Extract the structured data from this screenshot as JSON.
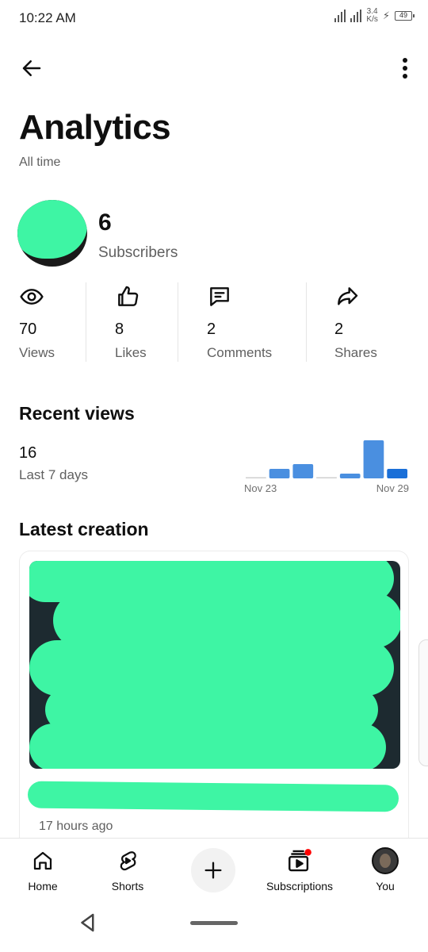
{
  "status_bar": {
    "time": "10:22 AM",
    "net_speed_value": "3.4",
    "net_speed_unit": "K/s",
    "battery": "49"
  },
  "header": {
    "title": "Analytics",
    "subtitle": "All time",
    "back_icon": "arrow-left-icon",
    "more_icon": "more-vertical-icon"
  },
  "channel": {
    "subscribers": "6",
    "subscribers_label": "Subscribers"
  },
  "stats": [
    {
      "icon": "eye-icon",
      "value": "70",
      "label": "Views"
    },
    {
      "icon": "thumbs-up-icon",
      "value": "8",
      "label": "Likes"
    },
    {
      "icon": "comment-icon",
      "value": "2",
      "label": "Comments"
    },
    {
      "icon": "share-icon",
      "value": "2",
      "label": "Shares"
    }
  ],
  "recent_views": {
    "title": "Recent views",
    "count": "16",
    "period": "Last 7 days"
  },
  "chart_data": {
    "type": "bar",
    "categories": [
      "Nov 23",
      "Nov 24",
      "Nov 25",
      "Nov 26",
      "Nov 27",
      "Nov 28",
      "Nov 29"
    ],
    "values": [
      0,
      2,
      3,
      0,
      1,
      8,
      2
    ],
    "tick_labels": [
      "Nov 23",
      "Nov 29"
    ],
    "colors": {
      "bar": "#4a8fe0",
      "bar_last": "#1a6fd8",
      "zero": "#cfcfcf"
    },
    "title": "",
    "xlabel": "",
    "ylabel": ""
  },
  "latest_creation": {
    "title": "Latest creation",
    "time_ago": "17 hours ago"
  },
  "bottom_nav": {
    "home": "Home",
    "shorts": "Shorts",
    "create_icon": "plus-icon",
    "subscriptions": "Subscriptions",
    "you": "You"
  },
  "colors": {
    "accent_red": "#ff0000",
    "text_primary": "#0f0f0f",
    "text_secondary": "#606060",
    "redaction": "#3ef5a4"
  }
}
